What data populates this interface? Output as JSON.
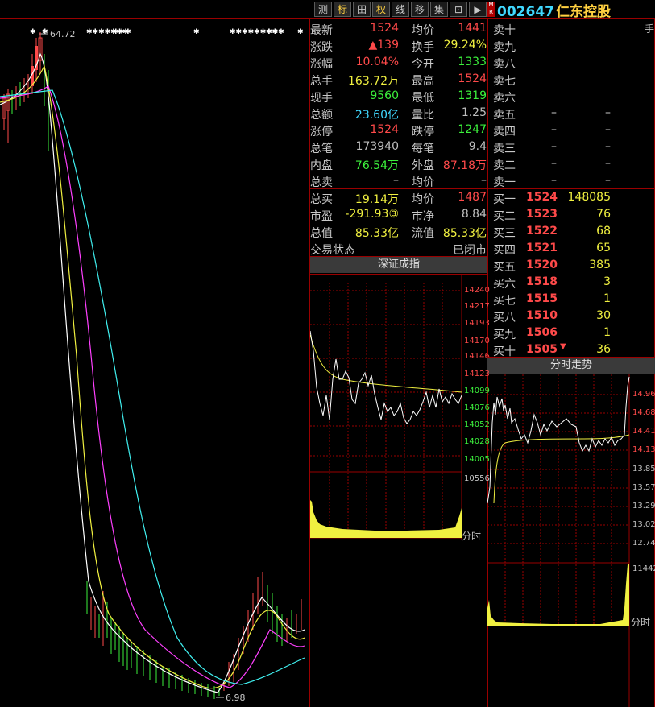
{
  "toolbar": {
    "buttons": [
      {
        "label": "测",
        "active": false
      },
      {
        "label": "标",
        "active": true
      },
      {
        "label": "田",
        "active": false
      },
      {
        "label": "权",
        "active": true
      },
      {
        "label": "线",
        "active": false
      },
      {
        "label": "移",
        "active": false
      },
      {
        "label": "集",
        "active": false
      },
      {
        "label": "⊡",
        "active": false
      },
      {
        "label": "▶",
        "active": false
      }
    ],
    "mr_tag": "M R"
  },
  "stock": {
    "code": "002647",
    "name": "仁东控股"
  },
  "kline": {
    "high_label": "64.72",
    "low_label": "6.98"
  },
  "quote": {
    "rows": [
      {
        "l1": "最新",
        "v1": "1524",
        "c1": "red",
        "l2": "均价",
        "v2": "1441",
        "c2": "red"
      },
      {
        "l1": "涨跌",
        "v1": "▲139",
        "c1": "red",
        "l2": "换手",
        "v2": "29.24%",
        "c2": "yellow"
      },
      {
        "l1": "涨幅",
        "v1": "10.04%",
        "c1": "red",
        "l2": "今开",
        "v2": "1333",
        "c2": "green"
      },
      {
        "l1": "总手",
        "v1": "163.72万",
        "c1": "yellow",
        "l2": "最高",
        "v2": "1524",
        "c2": "red"
      },
      {
        "l1": "现手",
        "v1": "9560",
        "c1": "green",
        "l2": "最低",
        "v2": "1319",
        "c2": "green"
      },
      {
        "l1": "总额",
        "v1": "23.60亿",
        "c1": "cyan",
        "l2": "量比",
        "v2": "1.25",
        "c2": "gray"
      },
      {
        "l1": "涨停",
        "v1": "1524",
        "c1": "red",
        "l2": "跌停",
        "v2": "1247",
        "c2": "green"
      },
      {
        "l1": "总笔",
        "v1": "173940",
        "c1": "gray",
        "l2": "每笔",
        "v2": "9.4",
        "c2": "gray"
      },
      {
        "l1": "内盘",
        "v1": "76.54万",
        "c1": "green",
        "l2": "外盘",
        "v2": "87.18万",
        "c2": "red"
      },
      {
        "l1": "总卖",
        "v1": "–",
        "c1": "gray",
        "l2": "均价",
        "v2": "–",
        "c2": "gray"
      },
      {
        "l1": "总买",
        "v1": "19.14万",
        "c1": "yellow",
        "l2": "均价",
        "v2": "1487",
        "c2": "red"
      },
      {
        "l1": "市盈",
        "v1": "-291.93③",
        "c1": "yellow",
        "l2": "市净",
        "v2": "8.84",
        "c2": "gray"
      },
      {
        "l1": "总值",
        "v1": "85.33亿",
        "c1": "yellow",
        "l2": "流值",
        "v2": "85.33亿",
        "c2": "yellow"
      },
      {
        "l1": "交易状态",
        "v1": "",
        "c1": "gray",
        "l2": "",
        "v2": "已闭市",
        "c2": "gray"
      }
    ]
  },
  "orderbook": {
    "unit_label": "手",
    "sell": [
      {
        "label": "卖十",
        "price": "",
        "vol": ""
      },
      {
        "label": "卖九",
        "price": "",
        "vol": ""
      },
      {
        "label": "卖八",
        "price": "",
        "vol": ""
      },
      {
        "label": "卖七",
        "price": "",
        "vol": ""
      },
      {
        "label": "卖六",
        "price": "",
        "vol": ""
      },
      {
        "label": "卖五",
        "price": "–",
        "vol": "–"
      },
      {
        "label": "卖四",
        "price": "–",
        "vol": "–"
      },
      {
        "label": "卖三",
        "price": "–",
        "vol": "–"
      },
      {
        "label": "卖二",
        "price": "–",
        "vol": "–"
      },
      {
        "label": "卖一",
        "price": "–",
        "vol": "–"
      }
    ],
    "buy": [
      {
        "label": "买一",
        "price": "1524",
        "vol": "148085"
      },
      {
        "label": "买二",
        "price": "1523",
        "vol": "76"
      },
      {
        "label": "买三",
        "price": "1522",
        "vol": "68"
      },
      {
        "label": "买四",
        "price": "1521",
        "vol": "65"
      },
      {
        "label": "买五",
        "price": "1520",
        "vol": "385"
      },
      {
        "label": "买六",
        "price": "1518",
        "vol": "3"
      },
      {
        "label": "买七",
        "price": "1515",
        "vol": "1"
      },
      {
        "label": "买八",
        "price": "1510",
        "vol": "30"
      },
      {
        "label": "买九",
        "price": "1506",
        "vol": "1"
      },
      {
        "label": "买十",
        "price": "1505",
        "vol": "36"
      }
    ]
  },
  "index_panel": {
    "title": "深证成指",
    "ticks": [
      "14240",
      "14217",
      "14193",
      "14170",
      "14146",
      "14123",
      "14099",
      "14076",
      "14052",
      "14028",
      "14005"
    ],
    "vol_tick": "10556",
    "time_label": "分时"
  },
  "intraday_panel": {
    "title": "分时走势",
    "ticks": [
      "14.96",
      "14.68",
      "14.41",
      "14.13",
      "13.85",
      "13.57",
      "13.29",
      "13.02",
      "12.74"
    ],
    "vol_tick": "11442",
    "time_label": "分时"
  },
  "colors": {
    "up": "#ff4a4a",
    "down": "#3cf03c",
    "ma5": "#ffffff",
    "ma10": "#f0f040",
    "ma20": "#ff40ff",
    "ma60": "#40f0f0",
    "frame": "#9a0000"
  }
}
